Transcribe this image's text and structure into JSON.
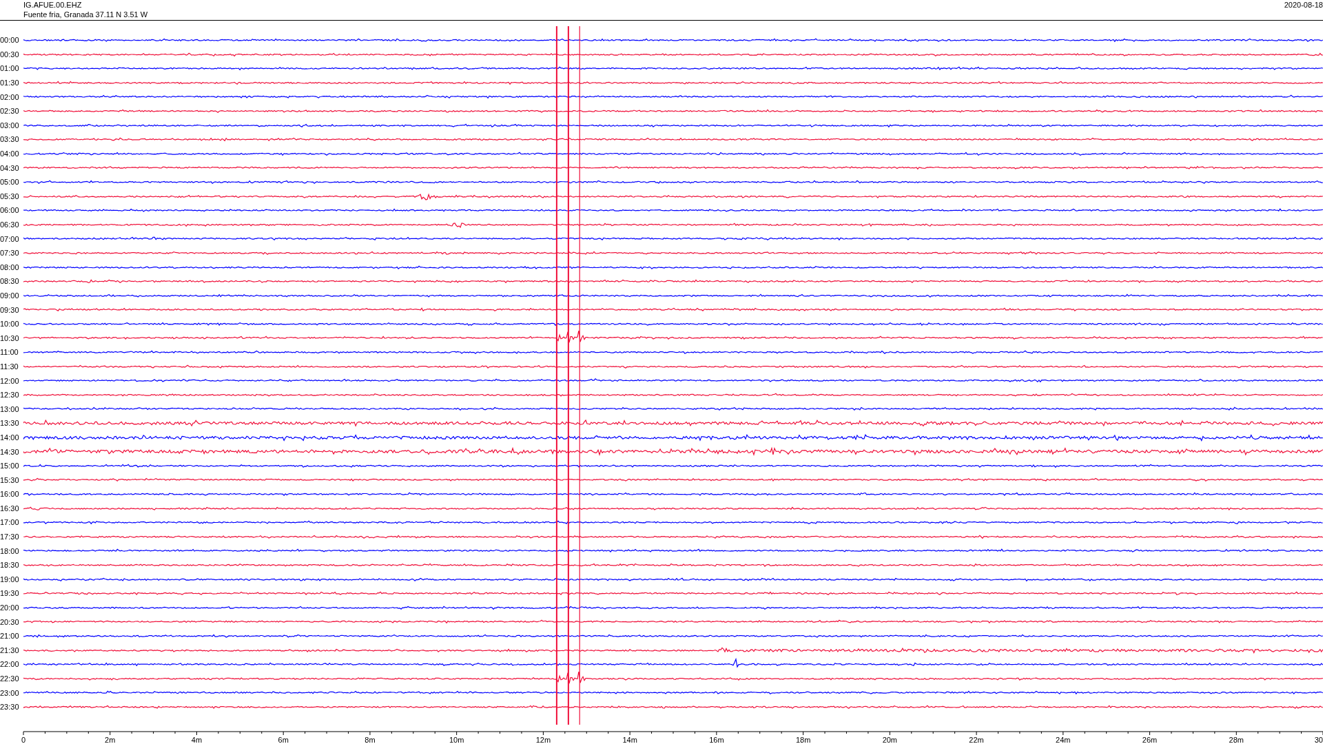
{
  "header": {
    "station": "IG.AFUE.00.EHZ",
    "location": "Fuente fria, Granada  37.11 N 3.51 W",
    "date": "2020-08-18"
  },
  "rows": [
    {
      "label": "00:00",
      "color": "#0000ff"
    },
    {
      "label": "00:30",
      "color": "#f0103a"
    },
    {
      "label": "01:00",
      "color": "#0000ff"
    },
    {
      "label": "01:30",
      "color": "#f0103a"
    },
    {
      "label": "02:00",
      "color": "#0000ff"
    },
    {
      "label": "02:30",
      "color": "#f0103a"
    },
    {
      "label": "03:00",
      "color": "#0000ff"
    },
    {
      "label": "03:30",
      "color": "#f0103a"
    },
    {
      "label": "04:00",
      "color": "#0000ff"
    },
    {
      "label": "04:30",
      "color": "#f0103a"
    },
    {
      "label": "05:00",
      "color": "#0000ff"
    },
    {
      "label": "05:30",
      "color": "#f0103a"
    },
    {
      "label": "06:00",
      "color": "#0000ff"
    },
    {
      "label": "06:30",
      "color": "#f0103a"
    },
    {
      "label": "07:00",
      "color": "#0000ff"
    },
    {
      "label": "07:30",
      "color": "#f0103a"
    },
    {
      "label": "08:00",
      "color": "#0000ff"
    },
    {
      "label": "08:30",
      "color": "#f0103a"
    },
    {
      "label": "09:00",
      "color": "#0000ff"
    },
    {
      "label": "09:30",
      "color": "#f0103a"
    },
    {
      "label": "10:00",
      "color": "#0000ff"
    },
    {
      "label": "10:30",
      "color": "#f0103a"
    },
    {
      "label": "11:00",
      "color": "#0000ff"
    },
    {
      "label": "11:30",
      "color": "#f0103a"
    },
    {
      "label": "12:00",
      "color": "#0000ff"
    },
    {
      "label": "12:30",
      "color": "#f0103a"
    },
    {
      "label": "13:00",
      "color": "#0000ff"
    },
    {
      "label": "13:30",
      "color": "#f0103a"
    },
    {
      "label": "14:00",
      "color": "#0000ff"
    },
    {
      "label": "14:30",
      "color": "#f0103a"
    },
    {
      "label": "15:00",
      "color": "#0000ff"
    },
    {
      "label": "15:30",
      "color": "#f0103a"
    },
    {
      "label": "16:00",
      "color": "#0000ff"
    },
    {
      "label": "16:30",
      "color": "#f0103a"
    },
    {
      "label": "17:00",
      "color": "#0000ff"
    },
    {
      "label": "17:30",
      "color": "#f0103a"
    },
    {
      "label": "18:00",
      "color": "#0000ff"
    },
    {
      "label": "18:30",
      "color": "#f0103a"
    },
    {
      "label": "19:00",
      "color": "#0000ff"
    },
    {
      "label": "19:30",
      "color": "#f0103a"
    },
    {
      "label": "20:00",
      "color": "#0000ff"
    },
    {
      "label": "20:30",
      "color": "#f0103a"
    },
    {
      "label": "21:00",
      "color": "#0000ff"
    },
    {
      "label": "21:30",
      "color": "#f0103a"
    },
    {
      "label": "22:00",
      "color": "#0000ff"
    },
    {
      "label": "22:30",
      "color": "#f0103a"
    },
    {
      "label": "23:00",
      "color": "#0000ff"
    },
    {
      "label": "23:30",
      "color": "#f0103a"
    }
  ],
  "x_axis": {
    "labels": [
      "0",
      "2m",
      "4m",
      "6m",
      "8m",
      "10m",
      "12m",
      "14m",
      "16m",
      "18m",
      "20m",
      "22m",
      "24m",
      "26m",
      "28m",
      "30"
    ]
  }
}
